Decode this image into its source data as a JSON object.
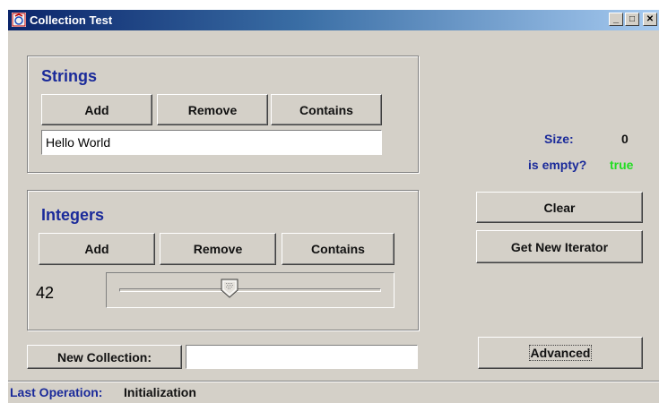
{
  "window": {
    "title": "Collection Test",
    "controls": {
      "minimize": "_",
      "maximize": "□",
      "close": "✕"
    }
  },
  "strings_group": {
    "title": "Strings",
    "add_label": "Add",
    "remove_label": "Remove",
    "contains_label": "Contains",
    "input_value": "Hello World"
  },
  "integers_group": {
    "title": "Integers",
    "add_label": "Add",
    "remove_label": "Remove",
    "contains_label": "Contains",
    "value_display": "42",
    "slider_level": 0.42
  },
  "info": {
    "size_label": "Size:",
    "size_value": "0",
    "empty_label": "is empty?",
    "empty_value": "true",
    "empty_value_color": "#22dd22",
    "label_color": "#1a2a9a"
  },
  "actions": {
    "clear_label": "Clear",
    "iterator_label": "Get New Iterator",
    "advanced_label": "Advanced"
  },
  "new_collection": {
    "button_label": "New Collection:",
    "input_value": ""
  },
  "status": {
    "label": "Last Operation:",
    "value": "Initialization"
  },
  "icons": [
    "app-icon",
    "minimize-icon",
    "maximize-icon",
    "close-icon",
    "slider-thumb-icon"
  ]
}
